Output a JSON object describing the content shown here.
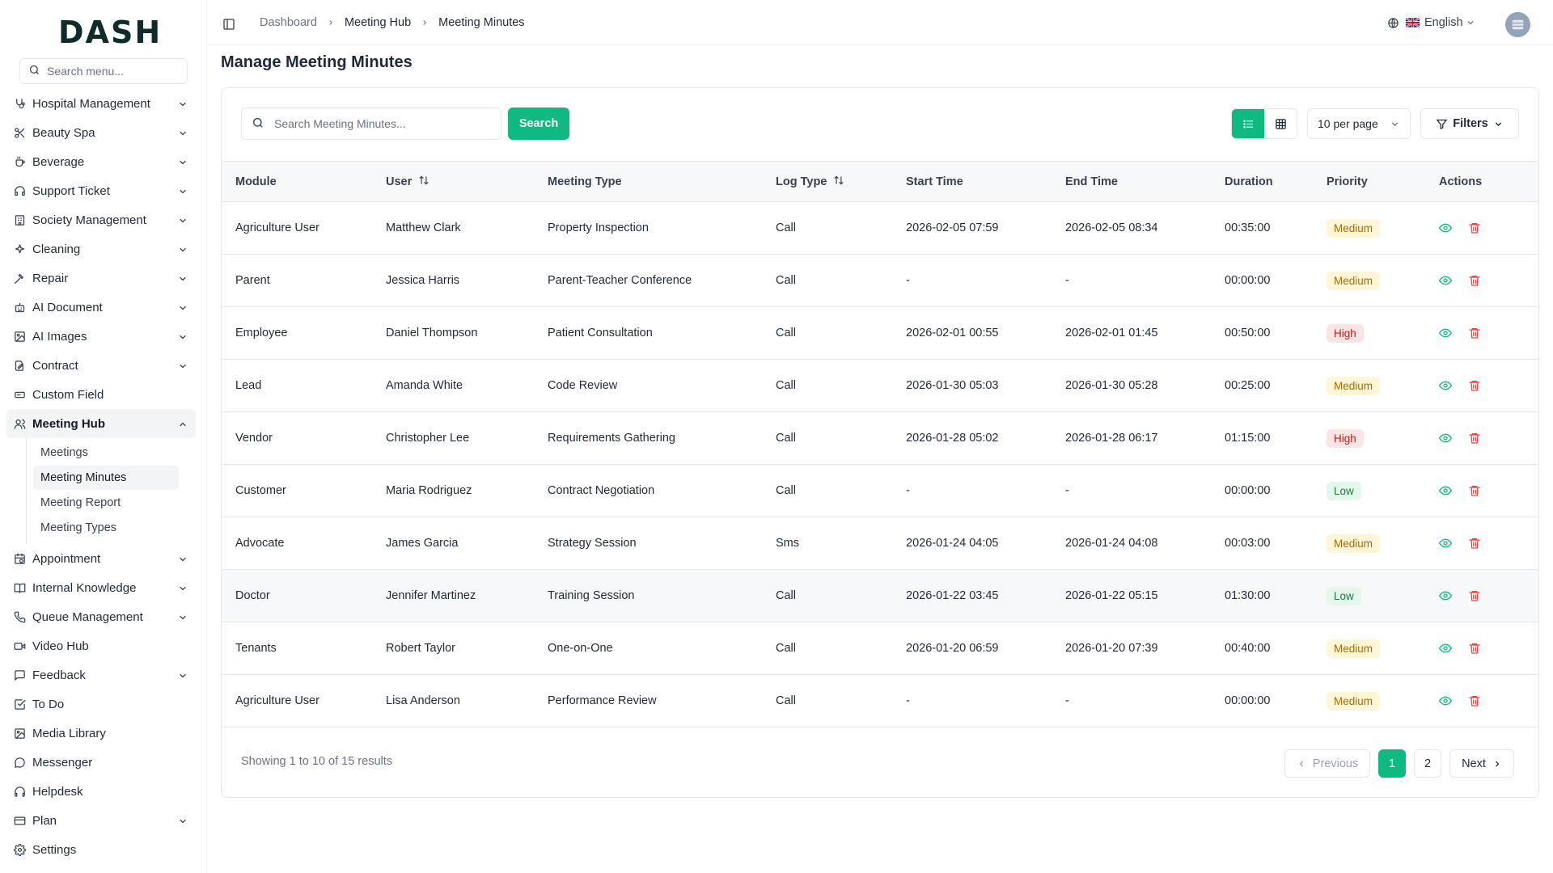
{
  "brand": {
    "logo_text": "DASH",
    "accent": "#10b981"
  },
  "sidebar": {
    "search_placeholder": "Search menu...",
    "items": [
      {
        "label": "Hospital Management",
        "icon": "stethoscope-icon",
        "has_children": true
      },
      {
        "label": "Beauty Spa",
        "icon": "scissors-icon",
        "has_children": true
      },
      {
        "label": "Beverage",
        "icon": "cup-icon",
        "has_children": true
      },
      {
        "label": "Support Ticket",
        "icon": "headset-icon",
        "has_children": true
      },
      {
        "label": "Society Management",
        "icon": "building-icon",
        "has_children": true
      },
      {
        "label": "Cleaning",
        "icon": "sparkle-icon",
        "has_children": true
      },
      {
        "label": "Repair",
        "icon": "hammer-icon",
        "has_children": true
      },
      {
        "label": "AI Document",
        "icon": "robot-icon",
        "has_children": true
      },
      {
        "label": "AI Images",
        "icon": "image-icon",
        "has_children": true
      },
      {
        "label": "Contract",
        "icon": "file-signature-icon",
        "has_children": true
      },
      {
        "label": "Custom Field",
        "icon": "input-field-icon",
        "has_children": false
      },
      {
        "label": "Meeting Hub",
        "icon": "users-icon",
        "has_children": true,
        "expanded": true
      },
      {
        "label": "Appointment",
        "icon": "calendar-clock-icon",
        "has_children": true
      },
      {
        "label": "Internal Knowledge",
        "icon": "book-open-icon",
        "has_children": true
      },
      {
        "label": "Queue Management",
        "icon": "phone-icon",
        "has_children": true
      },
      {
        "label": "Video Hub",
        "icon": "video-icon",
        "has_children": false
      },
      {
        "label": "Feedback",
        "icon": "message-square-icon",
        "has_children": true
      },
      {
        "label": "To Do",
        "icon": "check-square-icon",
        "has_children": false
      },
      {
        "label": "Media Library",
        "icon": "image-icon",
        "has_children": false
      },
      {
        "label": "Messenger",
        "icon": "message-circle-icon",
        "has_children": false
      },
      {
        "label": "Helpdesk",
        "icon": "headphones-icon",
        "has_children": false
      },
      {
        "label": "Plan",
        "icon": "credit-card-icon",
        "has_children": true
      },
      {
        "label": "Settings",
        "icon": "gear-icon",
        "has_children": false
      }
    ],
    "meeting_hub_children": [
      {
        "label": "Meetings",
        "active": false
      },
      {
        "label": "Meeting Minutes",
        "active": true
      },
      {
        "label": "Meeting Report",
        "active": false
      },
      {
        "label": "Meeting Types",
        "active": false
      }
    ]
  },
  "header": {
    "breadcrumb": [
      "Dashboard",
      "Meeting Hub",
      "Meeting Minutes"
    ],
    "language": "English"
  },
  "page": {
    "title": "Manage Meeting Minutes",
    "search_placeholder": "Search Meeting Minutes...",
    "search_button": "Search",
    "per_page": "10 per page",
    "filters_label": "Filters"
  },
  "table": {
    "columns": [
      "Module",
      "User",
      "Meeting Type",
      "Log Type",
      "Start Time",
      "End Time",
      "Duration",
      "Priority",
      "Actions"
    ],
    "rows": [
      {
        "module": "Agriculture User",
        "user": "Matthew Clark",
        "meeting_type": "Property Inspection",
        "log_type": "Call",
        "start": "2026-02-05 07:59",
        "end": "2026-02-05 08:34",
        "duration": "00:35:00",
        "priority": "Medium"
      },
      {
        "module": "Parent",
        "user": "Jessica Harris",
        "meeting_type": "Parent-Teacher Conference",
        "log_type": "Call",
        "start": "-",
        "end": "-",
        "duration": "00:00:00",
        "priority": "Medium"
      },
      {
        "module": "Employee",
        "user": "Daniel Thompson",
        "meeting_type": "Patient Consultation",
        "log_type": "Call",
        "start": "2026-02-01 00:55",
        "end": "2026-02-01 01:45",
        "duration": "00:50:00",
        "priority": "High"
      },
      {
        "module": "Lead",
        "user": "Amanda White",
        "meeting_type": "Code Review",
        "log_type": "Call",
        "start": "2026-01-30 05:03",
        "end": "2026-01-30 05:28",
        "duration": "00:25:00",
        "priority": "Medium"
      },
      {
        "module": "Vendor",
        "user": "Christopher Lee",
        "meeting_type": "Requirements Gathering",
        "log_type": "Call",
        "start": "2026-01-28 05:02",
        "end": "2026-01-28 06:17",
        "duration": "01:15:00",
        "priority": "High"
      },
      {
        "module": "Customer",
        "user": "Maria Rodriguez",
        "meeting_type": "Contract Negotiation",
        "log_type": "Call",
        "start": "-",
        "end": "-",
        "duration": "00:00:00",
        "priority": "Low"
      },
      {
        "module": "Advocate",
        "user": "James Garcia",
        "meeting_type": "Strategy Session",
        "log_type": "Sms",
        "start": "2026-01-24 04:05",
        "end": "2026-01-24 04:08",
        "duration": "00:03:00",
        "priority": "Medium"
      },
      {
        "module": "Doctor",
        "user": "Jennifer Martinez",
        "meeting_type": "Training Session",
        "log_type": "Call",
        "start": "2026-01-22 03:45",
        "end": "2026-01-22 05:15",
        "duration": "01:30:00",
        "priority": "Low"
      },
      {
        "module": "Tenants",
        "user": "Robert Taylor",
        "meeting_type": "One-on-One",
        "log_type": "Call",
        "start": "2026-01-20 06:59",
        "end": "2026-01-20 07:39",
        "duration": "00:40:00",
        "priority": "Medium"
      },
      {
        "module": "Agriculture User",
        "user": "Lisa Anderson",
        "meeting_type": "Performance Review",
        "log_type": "Call",
        "start": "-",
        "end": "-",
        "duration": "00:00:00",
        "priority": "Medium"
      }
    ]
  },
  "pagination": {
    "info": "Showing 1 to 10 of 15 results",
    "previous": "Previous",
    "pages": [
      "1",
      "2"
    ],
    "current": "1",
    "next": "Next"
  },
  "colors": {
    "medium": "#a86b07",
    "high": "#b42318",
    "low": "#16803c",
    "view_icon": "#10b981",
    "delete_icon": "#ef4444"
  }
}
